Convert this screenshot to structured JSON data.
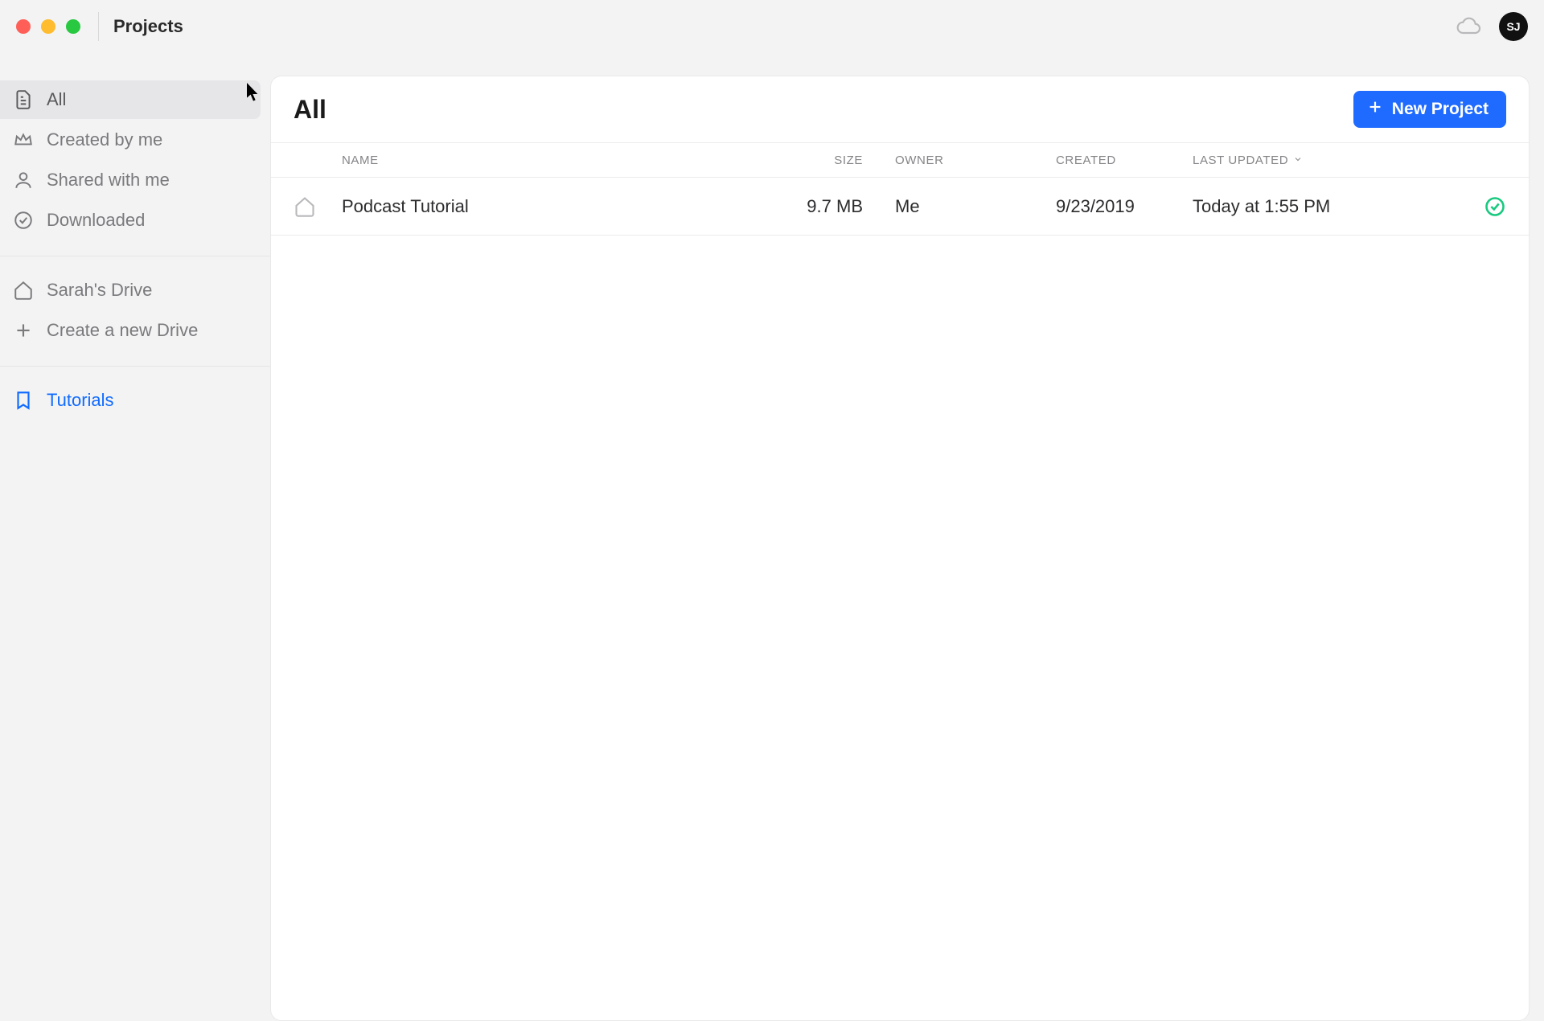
{
  "window": {
    "title": "Projects",
    "avatar_initials": "SJ"
  },
  "sidebar": {
    "filters": [
      {
        "label": "All"
      },
      {
        "label": "Created by me"
      },
      {
        "label": "Shared with me"
      },
      {
        "label": "Downloaded"
      }
    ],
    "drives": [
      {
        "label": "Sarah's Drive"
      },
      {
        "label": "Create a new Drive"
      }
    ],
    "bookmarks": [
      {
        "label": "Tutorials"
      }
    ]
  },
  "main": {
    "page_title": "All",
    "new_project_label": "New Project",
    "columns": {
      "name": "NAME",
      "size": "SIZE",
      "owner": "OWNER",
      "created": "CREATED",
      "updated": "LAST UPDATED"
    },
    "rows": [
      {
        "name": "Podcast Tutorial",
        "size": "9.7 MB",
        "owner": "Me",
        "created": "9/23/2019",
        "updated": "Today at 1:55 PM"
      }
    ]
  }
}
